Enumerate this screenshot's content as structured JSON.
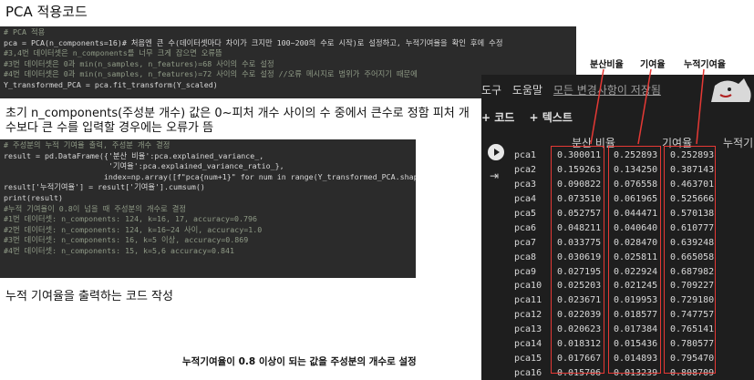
{
  "title": "PCA 적용코드",
  "code1": [
    {
      "t": "# PCA 적용",
      "c": "com"
    },
    {
      "t": "pca = PCA(n_components=16)# 처음엔 큰 수(데이터셋마다 차이가 크지만 100~200의 수로 시작)로 설정하고, 누적기여율을 확인 후에 수정",
      "c": "def"
    },
    {
      "t": "#3,4번 데이터셋은 n_components를 너무 크게 잡으면 오류뜸",
      "c": "com"
    },
    {
      "t": "#3번 데이터셋은 0과 min(n_samples, n_features)=68 사이의 수로 설정",
      "c": "com"
    },
    {
      "t": "#4번 데이터셋은 0과 min(n_samples, n_features)=72 사이의 수로 설정 //오류 메시지로 범위가 주어지기 때문에",
      "c": "com"
    },
    {
      "t": "Y_transformed_PCA = pca.fit_transform(Y_scaled)",
      "c": "def"
    }
  ],
  "note1": "초기 n_components(주성분 개수) 값은 0~피처 개수 사이의 수 중에서 큰수로 정함 피처 개수보다 큰 수를 입력할 경우에는 오류가 뜸",
  "code2": [
    {
      "t": "# 주성분의 누적 기여율 출력, 주성분 개수 결정",
      "c": "com"
    },
    {
      "t": "result = pd.DataFrame({'분산 비율':pca.explained_variance_,",
      "c": "def"
    },
    {
      "t": "                       '기여율':pca.explained_variance_ratio_},",
      "c": "def"
    },
    {
      "t": "                      index=np.array([f\"pca{num+1}\" for num in range(Y_transformed_PCA.shape[1])]))",
      "c": "def"
    },
    {
      "t": "result['누적기여율'] = result['기여율'].cumsum()",
      "c": "def"
    },
    {
      "t": "print(result)",
      "c": "def"
    },
    {
      "t": "#누적 기여율이 0.8이 넘을 때 주성분의 개수로 결정",
      "c": "com"
    },
    {
      "t": "#1번 데이터셋: n_components: 124, k=16, 17, accuracy=0.796",
      "c": "com"
    },
    {
      "t": "#2번 데이터셋: n_components: 124, k=16~24 사이, accuracy=1.0",
      "c": "com"
    },
    {
      "t": "#3번 데이터셋: n_components: 16, k=5 이상, accuracy=0.869",
      "c": "com"
    },
    {
      "t": "#4번 데이터셋: n_components: 15, k=5,6 accuracy=0.841",
      "c": "com"
    }
  ],
  "note2": "누적 기여율을 출력하는 코드 작성",
  "note3": "누적기여율이 0.8 이상이 되는 값을 주성분의 개수로 설정",
  "labels": {
    "variance": "분산비율",
    "ratio": "기여율",
    "cumulative": "누적기여율"
  },
  "notebook": {
    "menu": [
      "도구",
      "도움말"
    ],
    "saved": "모든 변경사항이 저장됨",
    "add_code": "+ 코드",
    "add_text": "+ 텍스트",
    "headers": [
      "분산 비율",
      "기여율",
      "누적기"
    ]
  },
  "table": {
    "rows": [
      [
        "pca1",
        "0.300011",
        "0.252893",
        "0.252893"
      ],
      [
        "pca2",
        "0.159263",
        "0.134250",
        "0.387143"
      ],
      [
        "pca3",
        "0.090822",
        "0.076558",
        "0.463701"
      ],
      [
        "pca4",
        "0.073510",
        "0.061965",
        "0.525666"
      ],
      [
        "pca5",
        "0.052757",
        "0.044471",
        "0.570138"
      ],
      [
        "pca6",
        "0.048211",
        "0.040640",
        "0.610777"
      ],
      [
        "pca7",
        "0.033775",
        "0.028470",
        "0.639248"
      ],
      [
        "pca8",
        "0.030619",
        "0.025811",
        "0.665058"
      ],
      [
        "pca9",
        "0.027195",
        "0.022924",
        "0.687982"
      ],
      [
        "pca10",
        "0.025203",
        "0.021245",
        "0.709227"
      ],
      [
        "pca11",
        "0.023671",
        "0.019953",
        "0.729180"
      ],
      [
        "pca12",
        "0.022039",
        "0.018577",
        "0.747757"
      ],
      [
        "pca13",
        "0.020623",
        "0.017384",
        "0.765141"
      ],
      [
        "pca14",
        "0.018312",
        "0.015436",
        "0.780577"
      ],
      [
        "pca15",
        "0.017667",
        "0.014893",
        "0.795470"
      ],
      [
        "pca16",
        "0.015706",
        "0.013239",
        "0.808709"
      ]
    ]
  },
  "colors": {
    "highlight": "#e53935",
    "code_bg": "#2b2b2b",
    "notebook_bg": "#1e1e1e"
  }
}
